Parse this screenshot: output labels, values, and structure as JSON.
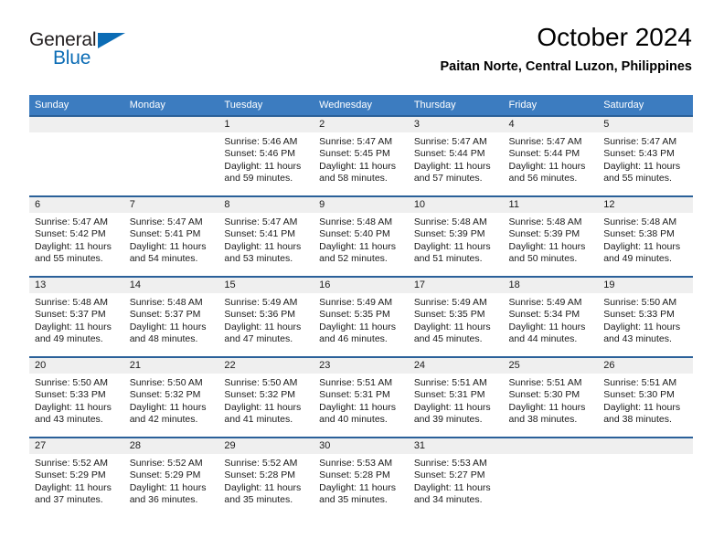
{
  "brand": {
    "word_general": "General",
    "word_blue": "Blue",
    "accent_color": "#0b6cb5"
  },
  "header": {
    "title": "October 2024",
    "location": "Paitan Norte, Central Luzon, Philippines"
  },
  "colors": {
    "header_blue": "#3c7cc0",
    "row_rule_blue": "#2a6099",
    "daynum_band": "#efefef"
  },
  "calendar": {
    "weekday_headers": [
      "Sunday",
      "Monday",
      "Tuesday",
      "Wednesday",
      "Thursday",
      "Friday",
      "Saturday"
    ],
    "labels": {
      "sunrise": "Sunrise:",
      "sunset": "Sunset:",
      "daylight": "Daylight:"
    },
    "weeks": [
      [
        {
          "day": "",
          "sunrise": "",
          "sunset": "",
          "daylight": ""
        },
        {
          "day": "",
          "sunrise": "",
          "sunset": "",
          "daylight": ""
        },
        {
          "day": "1",
          "sunrise": "Sunrise: 5:46 AM",
          "sunset": "Sunset: 5:46 PM",
          "daylight": "Daylight: 11 hours and 59 minutes."
        },
        {
          "day": "2",
          "sunrise": "Sunrise: 5:47 AM",
          "sunset": "Sunset: 5:45 PM",
          "daylight": "Daylight: 11 hours and 58 minutes."
        },
        {
          "day": "3",
          "sunrise": "Sunrise: 5:47 AM",
          "sunset": "Sunset: 5:44 PM",
          "daylight": "Daylight: 11 hours and 57 minutes."
        },
        {
          "day": "4",
          "sunrise": "Sunrise: 5:47 AM",
          "sunset": "Sunset: 5:44 PM",
          "daylight": "Daylight: 11 hours and 56 minutes."
        },
        {
          "day": "5",
          "sunrise": "Sunrise: 5:47 AM",
          "sunset": "Sunset: 5:43 PM",
          "daylight": "Daylight: 11 hours and 55 minutes."
        }
      ],
      [
        {
          "day": "6",
          "sunrise": "Sunrise: 5:47 AM",
          "sunset": "Sunset: 5:42 PM",
          "daylight": "Daylight: 11 hours and 55 minutes."
        },
        {
          "day": "7",
          "sunrise": "Sunrise: 5:47 AM",
          "sunset": "Sunset: 5:41 PM",
          "daylight": "Daylight: 11 hours and 54 minutes."
        },
        {
          "day": "8",
          "sunrise": "Sunrise: 5:47 AM",
          "sunset": "Sunset: 5:41 PM",
          "daylight": "Daylight: 11 hours and 53 minutes."
        },
        {
          "day": "9",
          "sunrise": "Sunrise: 5:48 AM",
          "sunset": "Sunset: 5:40 PM",
          "daylight": "Daylight: 11 hours and 52 minutes."
        },
        {
          "day": "10",
          "sunrise": "Sunrise: 5:48 AM",
          "sunset": "Sunset: 5:39 PM",
          "daylight": "Daylight: 11 hours and 51 minutes."
        },
        {
          "day": "11",
          "sunrise": "Sunrise: 5:48 AM",
          "sunset": "Sunset: 5:39 PM",
          "daylight": "Daylight: 11 hours and 50 minutes."
        },
        {
          "day": "12",
          "sunrise": "Sunrise: 5:48 AM",
          "sunset": "Sunset: 5:38 PM",
          "daylight": "Daylight: 11 hours and 49 minutes."
        }
      ],
      [
        {
          "day": "13",
          "sunrise": "Sunrise: 5:48 AM",
          "sunset": "Sunset: 5:37 PM",
          "daylight": "Daylight: 11 hours and 49 minutes."
        },
        {
          "day": "14",
          "sunrise": "Sunrise: 5:48 AM",
          "sunset": "Sunset: 5:37 PM",
          "daylight": "Daylight: 11 hours and 48 minutes."
        },
        {
          "day": "15",
          "sunrise": "Sunrise: 5:49 AM",
          "sunset": "Sunset: 5:36 PM",
          "daylight": "Daylight: 11 hours and 47 minutes."
        },
        {
          "day": "16",
          "sunrise": "Sunrise: 5:49 AM",
          "sunset": "Sunset: 5:35 PM",
          "daylight": "Daylight: 11 hours and 46 minutes."
        },
        {
          "day": "17",
          "sunrise": "Sunrise: 5:49 AM",
          "sunset": "Sunset: 5:35 PM",
          "daylight": "Daylight: 11 hours and 45 minutes."
        },
        {
          "day": "18",
          "sunrise": "Sunrise: 5:49 AM",
          "sunset": "Sunset: 5:34 PM",
          "daylight": "Daylight: 11 hours and 44 minutes."
        },
        {
          "day": "19",
          "sunrise": "Sunrise: 5:50 AM",
          "sunset": "Sunset: 5:33 PM",
          "daylight": "Daylight: 11 hours and 43 minutes."
        }
      ],
      [
        {
          "day": "20",
          "sunrise": "Sunrise: 5:50 AM",
          "sunset": "Sunset: 5:33 PM",
          "daylight": "Daylight: 11 hours and 43 minutes."
        },
        {
          "day": "21",
          "sunrise": "Sunrise: 5:50 AM",
          "sunset": "Sunset: 5:32 PM",
          "daylight": "Daylight: 11 hours and 42 minutes."
        },
        {
          "day": "22",
          "sunrise": "Sunrise: 5:50 AM",
          "sunset": "Sunset: 5:32 PM",
          "daylight": "Daylight: 11 hours and 41 minutes."
        },
        {
          "day": "23",
          "sunrise": "Sunrise: 5:51 AM",
          "sunset": "Sunset: 5:31 PM",
          "daylight": "Daylight: 11 hours and 40 minutes."
        },
        {
          "day": "24",
          "sunrise": "Sunrise: 5:51 AM",
          "sunset": "Sunset: 5:31 PM",
          "daylight": "Daylight: 11 hours and 39 minutes."
        },
        {
          "day": "25",
          "sunrise": "Sunrise: 5:51 AM",
          "sunset": "Sunset: 5:30 PM",
          "daylight": "Daylight: 11 hours and 38 minutes."
        },
        {
          "day": "26",
          "sunrise": "Sunrise: 5:51 AM",
          "sunset": "Sunset: 5:30 PM",
          "daylight": "Daylight: 11 hours and 38 minutes."
        }
      ],
      [
        {
          "day": "27",
          "sunrise": "Sunrise: 5:52 AM",
          "sunset": "Sunset: 5:29 PM",
          "daylight": "Daylight: 11 hours and 37 minutes."
        },
        {
          "day": "28",
          "sunrise": "Sunrise: 5:52 AM",
          "sunset": "Sunset: 5:29 PM",
          "daylight": "Daylight: 11 hours and 36 minutes."
        },
        {
          "day": "29",
          "sunrise": "Sunrise: 5:52 AM",
          "sunset": "Sunset: 5:28 PM",
          "daylight": "Daylight: 11 hours and 35 minutes."
        },
        {
          "day": "30",
          "sunrise": "Sunrise: 5:53 AM",
          "sunset": "Sunset: 5:28 PM",
          "daylight": "Daylight: 11 hours and 35 minutes."
        },
        {
          "day": "31",
          "sunrise": "Sunrise: 5:53 AM",
          "sunset": "Sunset: 5:27 PM",
          "daylight": "Daylight: 11 hours and 34 minutes."
        },
        {
          "day": "",
          "sunrise": "",
          "sunset": "",
          "daylight": ""
        },
        {
          "day": "",
          "sunrise": "",
          "sunset": "",
          "daylight": ""
        }
      ]
    ]
  }
}
